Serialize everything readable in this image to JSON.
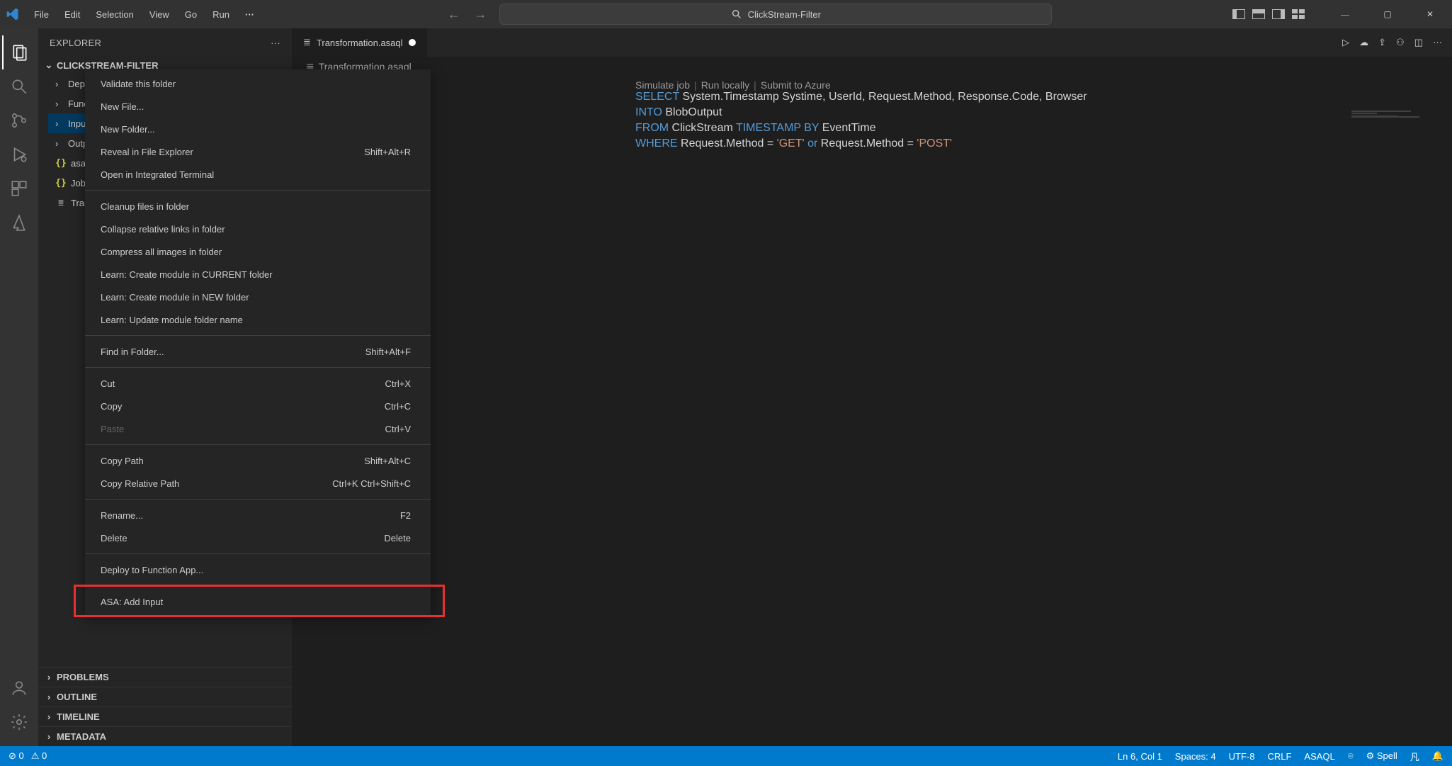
{
  "titleText": "ClickStream-Filter",
  "menu": [
    "File",
    "Edit",
    "Selection",
    "View",
    "Go",
    "Run"
  ],
  "explorer": {
    "header": "EXPLORER",
    "root": "CLICKSTREAM-FILTER",
    "items": [
      {
        "label": "Deplo",
        "type": "folder"
      },
      {
        "label": "Funct",
        "type": "folder"
      },
      {
        "label": "Inputs",
        "type": "folder",
        "selected": true
      },
      {
        "label": "Outp",
        "type": "folder"
      },
      {
        "label": "asapr",
        "type": "json"
      },
      {
        "label": "JobCo",
        "type": "json"
      },
      {
        "label": "Transf",
        "type": "file"
      }
    ],
    "collapsed": [
      "PROBLEMS",
      "OUTLINE",
      "TIMELINE",
      "METADATA"
    ]
  },
  "tab": {
    "title": "Transformation.asaql",
    "breadcrumb": "Transformation.asaql"
  },
  "runBar": {
    "sim": "Simulate job",
    "local": "Run locally",
    "submit": "Submit to Azure"
  },
  "code": {
    "l1_a": "SELECT",
    "l1_b": " System.Timestamp Systime, UserId, Request.Method, Response.Code, Browser",
    "l2_a": "INTO",
    "l2_b": " BlobOutput",
    "l3_a": "FROM",
    "l3_b": " ClickStream ",
    "l3_c": "TIMESTAMP BY",
    "l3_d": " EventTime",
    "l4_a": "WHERE",
    "l4_b": " Request.Method = ",
    "l4_c": "'GET'",
    "l4_d": " or ",
    "l4_e": "Request.Method = ",
    "l4_f": "'POST'"
  },
  "contextMenu": {
    "groups": [
      [
        {
          "label": "Validate this folder"
        },
        {
          "label": "New File..."
        },
        {
          "label": "New Folder..."
        },
        {
          "label": "Reveal in File Explorer",
          "shortcut": "Shift+Alt+R"
        },
        {
          "label": "Open in Integrated Terminal"
        }
      ],
      [
        {
          "label": "Cleanup files in folder"
        },
        {
          "label": "Collapse relative links in folder"
        },
        {
          "label": "Compress all images in folder"
        },
        {
          "label": "Learn: Create module in CURRENT folder"
        },
        {
          "label": "Learn: Create module in NEW folder"
        },
        {
          "label": "Learn: Update module folder name"
        }
      ],
      [
        {
          "label": "Find in Folder...",
          "shortcut": "Shift+Alt+F"
        }
      ],
      [
        {
          "label": "Cut",
          "shortcut": "Ctrl+X"
        },
        {
          "label": "Copy",
          "shortcut": "Ctrl+C"
        },
        {
          "label": "Paste",
          "shortcut": "Ctrl+V",
          "disabled": true
        }
      ],
      [
        {
          "label": "Copy Path",
          "shortcut": "Shift+Alt+C"
        },
        {
          "label": "Copy Relative Path",
          "shortcut": "Ctrl+K Ctrl+Shift+C"
        }
      ],
      [
        {
          "label": "Rename...",
          "shortcut": "F2"
        },
        {
          "label": "Delete",
          "shortcut": "Delete"
        }
      ],
      [
        {
          "label": "Deploy to Function App..."
        }
      ],
      [
        {
          "label": "ASA: Add Input"
        }
      ]
    ]
  },
  "status": {
    "errors": "0",
    "warnings": "0",
    "right": [
      "Ln 6, Col 1",
      "Spaces: 4",
      "UTF-8",
      "CRLF",
      "ASAQL",
      "Spell"
    ]
  }
}
